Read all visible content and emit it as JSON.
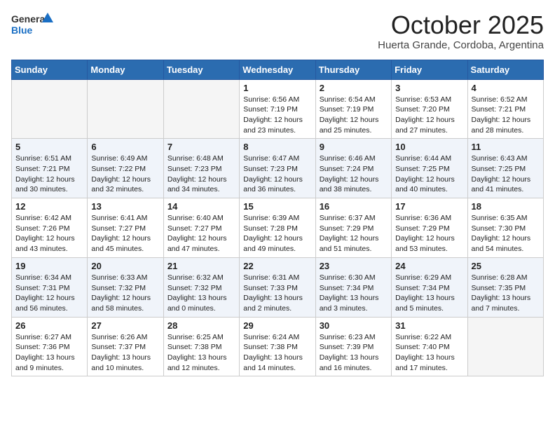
{
  "header": {
    "logo_general": "General",
    "logo_blue": "Blue",
    "month": "October 2025",
    "location": "Huerta Grande, Cordoba, Argentina"
  },
  "days_of_week": [
    "Sunday",
    "Monday",
    "Tuesday",
    "Wednesday",
    "Thursday",
    "Friday",
    "Saturday"
  ],
  "weeks": [
    [
      {
        "day": "",
        "info": ""
      },
      {
        "day": "",
        "info": ""
      },
      {
        "day": "",
        "info": ""
      },
      {
        "day": "1",
        "info": "Sunrise: 6:56 AM\nSunset: 7:19 PM\nDaylight: 12 hours\nand 23 minutes."
      },
      {
        "day": "2",
        "info": "Sunrise: 6:54 AM\nSunset: 7:19 PM\nDaylight: 12 hours\nand 25 minutes."
      },
      {
        "day": "3",
        "info": "Sunrise: 6:53 AM\nSunset: 7:20 PM\nDaylight: 12 hours\nand 27 minutes."
      },
      {
        "day": "4",
        "info": "Sunrise: 6:52 AM\nSunset: 7:21 PM\nDaylight: 12 hours\nand 28 minutes."
      }
    ],
    [
      {
        "day": "5",
        "info": "Sunrise: 6:51 AM\nSunset: 7:21 PM\nDaylight: 12 hours\nand 30 minutes."
      },
      {
        "day": "6",
        "info": "Sunrise: 6:49 AM\nSunset: 7:22 PM\nDaylight: 12 hours\nand 32 minutes."
      },
      {
        "day": "7",
        "info": "Sunrise: 6:48 AM\nSunset: 7:23 PM\nDaylight: 12 hours\nand 34 minutes."
      },
      {
        "day": "8",
        "info": "Sunrise: 6:47 AM\nSunset: 7:23 PM\nDaylight: 12 hours\nand 36 minutes."
      },
      {
        "day": "9",
        "info": "Sunrise: 6:46 AM\nSunset: 7:24 PM\nDaylight: 12 hours\nand 38 minutes."
      },
      {
        "day": "10",
        "info": "Sunrise: 6:44 AM\nSunset: 7:25 PM\nDaylight: 12 hours\nand 40 minutes."
      },
      {
        "day": "11",
        "info": "Sunrise: 6:43 AM\nSunset: 7:25 PM\nDaylight: 12 hours\nand 41 minutes."
      }
    ],
    [
      {
        "day": "12",
        "info": "Sunrise: 6:42 AM\nSunset: 7:26 PM\nDaylight: 12 hours\nand 43 minutes."
      },
      {
        "day": "13",
        "info": "Sunrise: 6:41 AM\nSunset: 7:27 PM\nDaylight: 12 hours\nand 45 minutes."
      },
      {
        "day": "14",
        "info": "Sunrise: 6:40 AM\nSunset: 7:27 PM\nDaylight: 12 hours\nand 47 minutes."
      },
      {
        "day": "15",
        "info": "Sunrise: 6:39 AM\nSunset: 7:28 PM\nDaylight: 12 hours\nand 49 minutes."
      },
      {
        "day": "16",
        "info": "Sunrise: 6:37 AM\nSunset: 7:29 PM\nDaylight: 12 hours\nand 51 minutes."
      },
      {
        "day": "17",
        "info": "Sunrise: 6:36 AM\nSunset: 7:29 PM\nDaylight: 12 hours\nand 53 minutes."
      },
      {
        "day": "18",
        "info": "Sunrise: 6:35 AM\nSunset: 7:30 PM\nDaylight: 12 hours\nand 54 minutes."
      }
    ],
    [
      {
        "day": "19",
        "info": "Sunrise: 6:34 AM\nSunset: 7:31 PM\nDaylight: 12 hours\nand 56 minutes."
      },
      {
        "day": "20",
        "info": "Sunrise: 6:33 AM\nSunset: 7:32 PM\nDaylight: 12 hours\nand 58 minutes."
      },
      {
        "day": "21",
        "info": "Sunrise: 6:32 AM\nSunset: 7:32 PM\nDaylight: 13 hours\nand 0 minutes."
      },
      {
        "day": "22",
        "info": "Sunrise: 6:31 AM\nSunset: 7:33 PM\nDaylight: 13 hours\nand 2 minutes."
      },
      {
        "day": "23",
        "info": "Sunrise: 6:30 AM\nSunset: 7:34 PM\nDaylight: 13 hours\nand 3 minutes."
      },
      {
        "day": "24",
        "info": "Sunrise: 6:29 AM\nSunset: 7:34 PM\nDaylight: 13 hours\nand 5 minutes."
      },
      {
        "day": "25",
        "info": "Sunrise: 6:28 AM\nSunset: 7:35 PM\nDaylight: 13 hours\nand 7 minutes."
      }
    ],
    [
      {
        "day": "26",
        "info": "Sunrise: 6:27 AM\nSunset: 7:36 PM\nDaylight: 13 hours\nand 9 minutes."
      },
      {
        "day": "27",
        "info": "Sunrise: 6:26 AM\nSunset: 7:37 PM\nDaylight: 13 hours\nand 10 minutes."
      },
      {
        "day": "28",
        "info": "Sunrise: 6:25 AM\nSunset: 7:38 PM\nDaylight: 13 hours\nand 12 minutes."
      },
      {
        "day": "29",
        "info": "Sunrise: 6:24 AM\nSunset: 7:38 PM\nDaylight: 13 hours\nand 14 minutes."
      },
      {
        "day": "30",
        "info": "Sunrise: 6:23 AM\nSunset: 7:39 PM\nDaylight: 13 hours\nand 16 minutes."
      },
      {
        "day": "31",
        "info": "Sunrise: 6:22 AM\nSunset: 7:40 PM\nDaylight: 13 hours\nand 17 minutes."
      },
      {
        "day": "",
        "info": ""
      }
    ]
  ]
}
